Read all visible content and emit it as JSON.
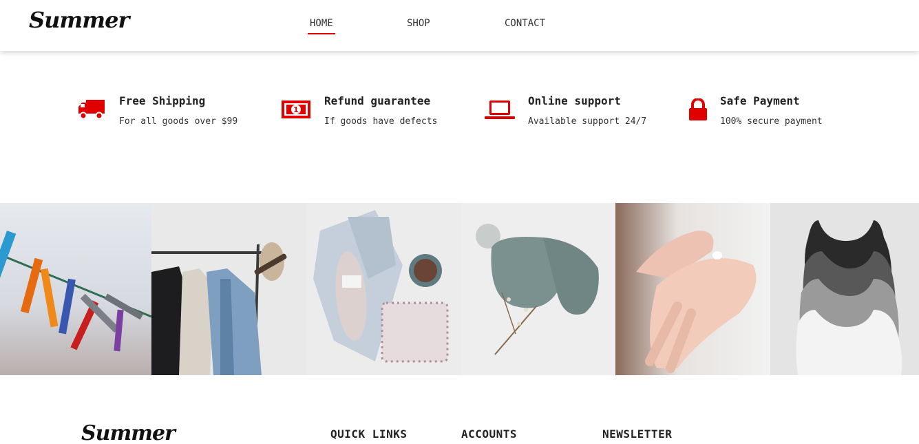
{
  "header": {
    "logo": "Summer",
    "nav": [
      "HOME",
      "SHOP",
      "CONTACT"
    ]
  },
  "features": [
    {
      "icon": "truck-icon",
      "title": "Free Shipping",
      "desc": "For all goods over $99"
    },
    {
      "icon": "money-icon",
      "title": "Refund guarantee",
      "desc": "If goods have defects"
    },
    {
      "icon": "laptop-icon",
      "title": "Online support",
      "desc": "Available support 24/7"
    },
    {
      "icon": "lock-icon",
      "title": "Safe Payment",
      "desc": "100% secure payment"
    }
  ],
  "gallery": [
    "clothespins",
    "clothing-rack",
    "knitwear-flatlay",
    "knitted-baby-hat",
    "hand-cream",
    "tank-tops"
  ],
  "footer": {
    "logo": "Summer",
    "headings": [
      "QUICK LINKS",
      "ACCOUNTS",
      "NEWSLETTER"
    ]
  },
  "colors": {
    "accent": "#e00000",
    "text": "#222222"
  }
}
